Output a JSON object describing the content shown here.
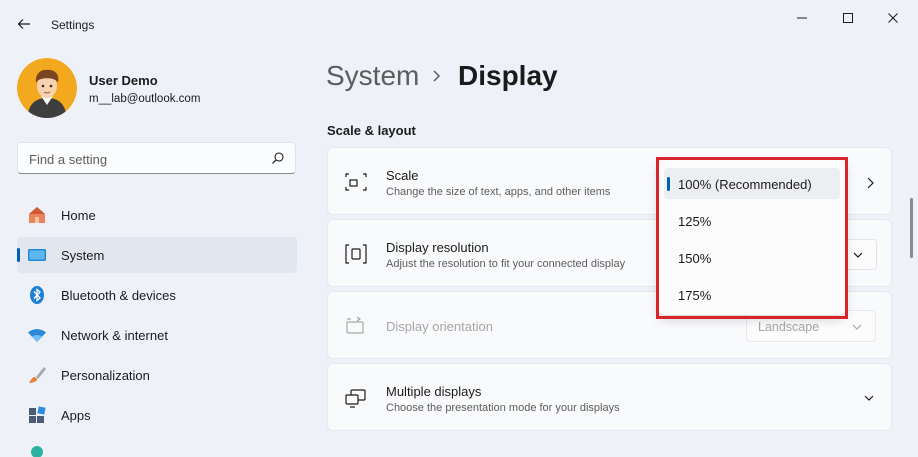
{
  "window": {
    "title": "Settings"
  },
  "user": {
    "name": "User Demo",
    "email": "m__lab@outlook.com"
  },
  "search": {
    "placeholder": "Find a setting"
  },
  "sidebar": {
    "items": [
      {
        "label": "Home",
        "icon": "home-icon"
      },
      {
        "label": "System",
        "icon": "system-icon",
        "active": true
      },
      {
        "label": "Bluetooth & devices",
        "icon": "bluetooth-icon"
      },
      {
        "label": "Network & internet",
        "icon": "wifi-icon"
      },
      {
        "label": "Personalization",
        "icon": "brush-icon"
      },
      {
        "label": "Apps",
        "icon": "apps-icon"
      }
    ]
  },
  "breadcrumb": {
    "parent": "System",
    "current": "Display"
  },
  "section": {
    "title": "Scale & layout"
  },
  "cards": {
    "scale": {
      "title": "Scale",
      "desc": "Change the size of text, apps, and other items"
    },
    "resolution": {
      "title": "Display resolution",
      "desc": "Adjust the resolution to fit your connected display"
    },
    "orientation": {
      "title": "Display orientation",
      "value": "Landscape"
    },
    "multiple": {
      "title": "Multiple displays",
      "desc": "Choose the presentation mode for your displays"
    }
  },
  "scale_dropdown": {
    "options": [
      "100% (Recommended)",
      "125%",
      "150%",
      "175%"
    ],
    "selected": "100% (Recommended)"
  },
  "colors": {
    "accent": "#005fb8",
    "highlight": "#d8242b",
    "background": "#eef2f8"
  }
}
